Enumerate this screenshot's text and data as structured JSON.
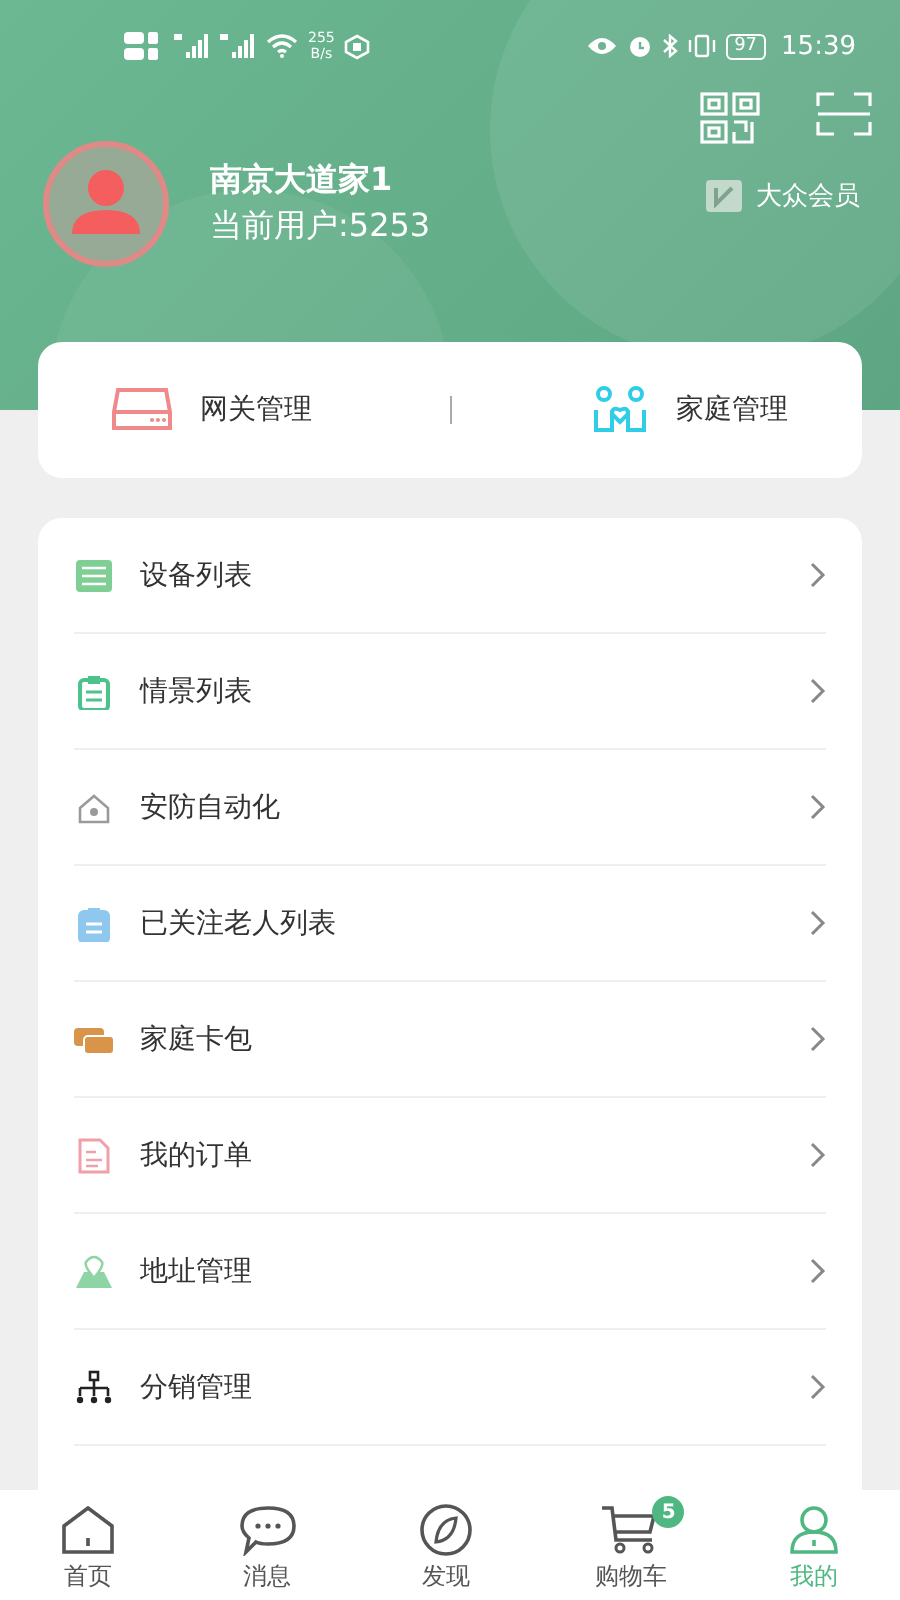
{
  "status_bar": {
    "net_speed": "255",
    "net_unit": "B/s",
    "battery": "97",
    "time": "15:39"
  },
  "profile": {
    "name": "南京大道家1",
    "user": "当前用户:5253",
    "membership": "大众会员"
  },
  "quick_actions": [
    {
      "label": "网关管理",
      "kind": "gateway"
    },
    {
      "label": "家庭管理",
      "kind": "family"
    }
  ],
  "menu": [
    {
      "label": "设备列表",
      "kind": "devices",
      "color": "#7fcf95"
    },
    {
      "label": "情景列表",
      "kind": "scenes",
      "color": "#4cc38a"
    },
    {
      "label": "安防自动化",
      "kind": "security",
      "color": "#9a9a9a"
    },
    {
      "label": "已关注老人列表",
      "kind": "elders",
      "color": "#8ec8ee"
    },
    {
      "label": "家庭卡包",
      "kind": "cards",
      "color": "#d9944a"
    },
    {
      "label": "我的订单",
      "kind": "orders",
      "color": "#f0a0a8"
    },
    {
      "label": "地址管理",
      "kind": "address",
      "color": "#8fd4a4"
    },
    {
      "label": "分销管理",
      "kind": "distribution",
      "color": "#222222"
    }
  ],
  "tab_bar": [
    {
      "label": "首页",
      "kind": "home",
      "selected": false
    },
    {
      "label": "消息",
      "kind": "messages",
      "selected": false
    },
    {
      "label": "发现",
      "kind": "discover",
      "selected": false
    },
    {
      "label": "购物车",
      "kind": "cart",
      "selected": false,
      "badge": "5"
    },
    {
      "label": "我的",
      "kind": "me",
      "selected": true
    }
  ]
}
